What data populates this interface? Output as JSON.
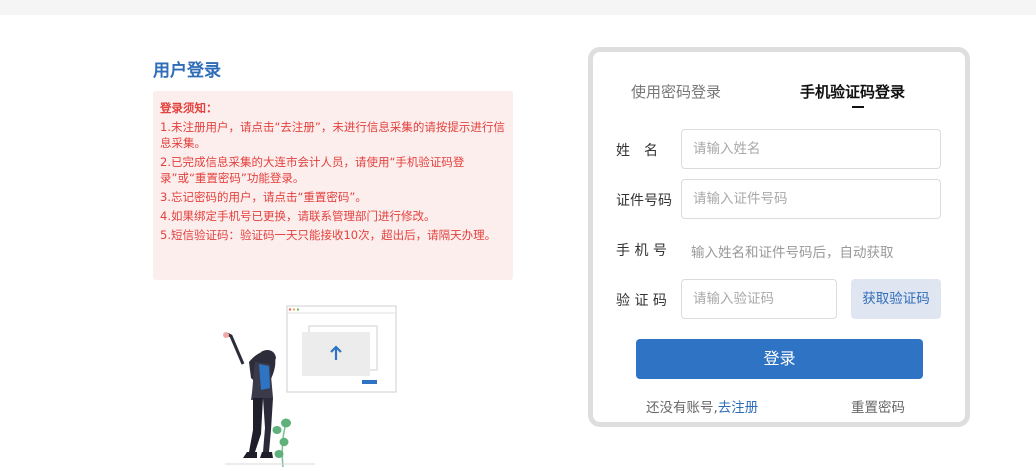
{
  "left": {
    "title": "用户登录",
    "notice": {
      "heading": "登录须知：",
      "items": [
        "1.未注册用户，请点击“去注册”，未进行信息采集的请按提示进行信息采集。",
        "2.已完成信息采集的大连市会计人员，请使用“手机验证码登录”或“重置密码”功能登录。",
        "3.忘记密码的用户，请点击“重置密码”。",
        "4.如果绑定手机号已更换，请联系管理部门进行修改。",
        "5.短信验证码：验证码一天只能接收10次，超出后，请隔天办理。"
      ]
    }
  },
  "login": {
    "tabs": {
      "password": "使用密码登录",
      "sms": "手机验证码登录"
    },
    "active_tab": "sms",
    "fields": {
      "name": {
        "label": "姓　名",
        "placeholder": "请输入姓名"
      },
      "id_number": {
        "label": "证件号码",
        "placeholder": "请输入证件号码"
      },
      "phone": {
        "label": "手 机 号",
        "hint": "输入姓名和证件号码后，自动获取"
      },
      "code": {
        "label": "验 证 码",
        "placeholder": "请输入验证码"
      }
    },
    "get_code_label": "获取验证码",
    "submit_label": "登录",
    "no_account_text": "还没有账号,",
    "register_link": "去注册",
    "reset_link": "重置密码"
  },
  "colors": {
    "brand_blue": "#2f74c4",
    "link_blue": "#2f6db8",
    "notice_bg": "#fdeeee",
    "notice_text": "#e2413d"
  },
  "icons": [
    "upload-arrow-icon"
  ]
}
